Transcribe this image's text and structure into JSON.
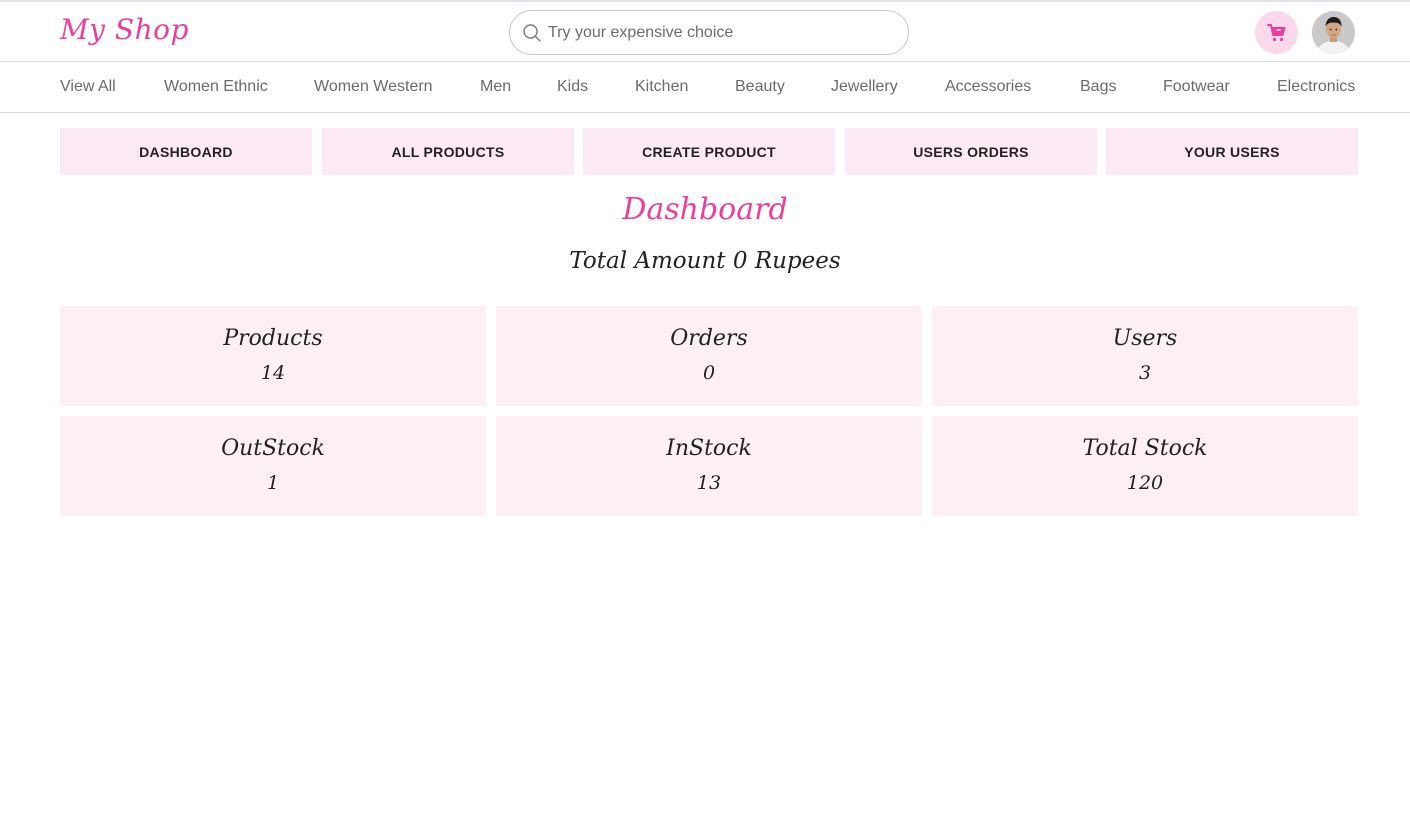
{
  "header": {
    "logo": "My Shop",
    "search_placeholder": "Try your expensive choice",
    "search_icon": "search-icon",
    "cart_icon": "cart-icon",
    "accent_color": "#e8409b"
  },
  "categories": [
    "View All",
    "Women Ethnic",
    "Women Western",
    "Men",
    "Kids",
    "Kitchen",
    "Beauty",
    "Jewellery",
    "Accessories",
    "Bags",
    "Footwear",
    "Electronics"
  ],
  "tabs": [
    "DASHBOARD",
    "ALL PRODUCTS",
    "CREATE PRODUCT",
    "USERS ORDERS",
    "YOUR USERS"
  ],
  "dashboard": {
    "title": "Dashboard",
    "total_amount": "Total Amount 0 Rupees",
    "cards": [
      {
        "label": "Products",
        "value": "14"
      },
      {
        "label": "Orders",
        "value": "0"
      },
      {
        "label": "Users",
        "value": "3"
      },
      {
        "label": "OutStock",
        "value": "1"
      },
      {
        "label": "InStock",
        "value": "13"
      },
      {
        "label": "Total Stock",
        "value": "120"
      }
    ]
  }
}
